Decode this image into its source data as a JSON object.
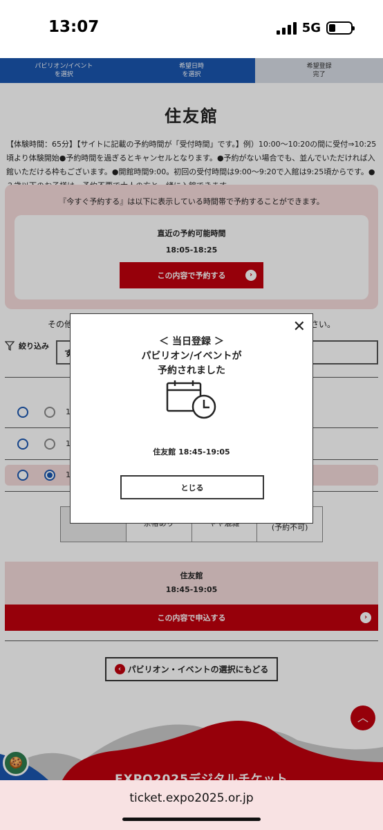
{
  "status": {
    "time": "13:07",
    "network": "5G"
  },
  "steps": [
    {
      "line1": "パビリオン/イベント",
      "line2": "を選択"
    },
    {
      "line1": "希望日時",
      "line2": "を選択"
    },
    {
      "line1": "希望登録",
      "line2": "完了"
    }
  ],
  "page": {
    "title": "住友館",
    "description": "【体験時間：65分】【サイトに記載の予約時間が「受付時間」です。】例）10:00〜10:20の間に受付⇒10:25頃より体験開始●予約時間を過ぎるとキャンセルとなります。●予約がない場合でも、並んでいただければ入館いただける枠もございます。●開館時間9:00。初回の受付時間は9:00〜9:20で入館は9:25頃からです。●３歳以下のお子様は、予約不要で大人の方と一緒に入館できます。",
    "reserve_note": "『今すぐ予約する』は以下に表示している時間帯で予約することができます。",
    "nearest_label": "直近の予約可能時間",
    "nearest_time": "18:05-18:25",
    "reserve_button": "この内容で予約する",
    "other_line_left": "その他の",
    "other_line_right": "ださい。",
    "filter_label": "絞り込み",
    "filter_value": "す",
    "rows": [
      {
        "prefix": "1"
      },
      {
        "prefix": "1"
      },
      {
        "prefix": "1"
      }
    ],
    "legend": [
      "",
      "余裕あり",
      "やや混雑",
      "満員です\n(予約不可)"
    ],
    "summary_name": "住友館",
    "summary_time": "18:45-19:05",
    "apply_button": "この内容で申込する",
    "back_button": "パビリオン・イベントの選択にもどる",
    "footer_title": "EXPO2025デジタルチケット"
  },
  "modal": {
    "line1": "＜ 当日登録 ＞",
    "line2": "パビリオン/イベントが",
    "line3": "予約されました",
    "info": "住友館 18:45-19:05",
    "close_button": "とじる"
  },
  "urlbar": {
    "url": "ticket.expo2025.or.jp"
  },
  "colors": {
    "brand_red": "#c0000e",
    "brand_blue": "#1a56b0"
  }
}
